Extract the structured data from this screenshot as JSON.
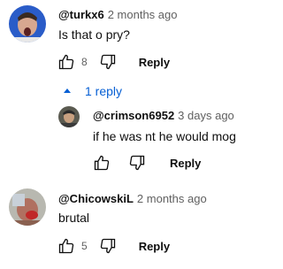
{
  "comments": [
    {
      "handle": "@turkx6",
      "time": "2 months ago",
      "text": "Is that o pry?",
      "likes": "8",
      "reply_label": "Reply"
    },
    {
      "handle": "@ChicowskiL",
      "time": "2 months ago",
      "text": "brutal",
      "likes": "5",
      "reply_label": "Reply"
    }
  ],
  "replies_toggle": {
    "label": "1 reply"
  },
  "reply": {
    "handle": "@crimson6952",
    "time": "3 days ago",
    "text": "if he was nt he would mog",
    "reply_label": "Reply"
  },
  "colors": {
    "link_blue": "#065fd4",
    "meta_gray": "#606060"
  },
  "icons": [
    "thumbs-up-icon",
    "thumbs-down-icon",
    "caret-up-icon"
  ]
}
